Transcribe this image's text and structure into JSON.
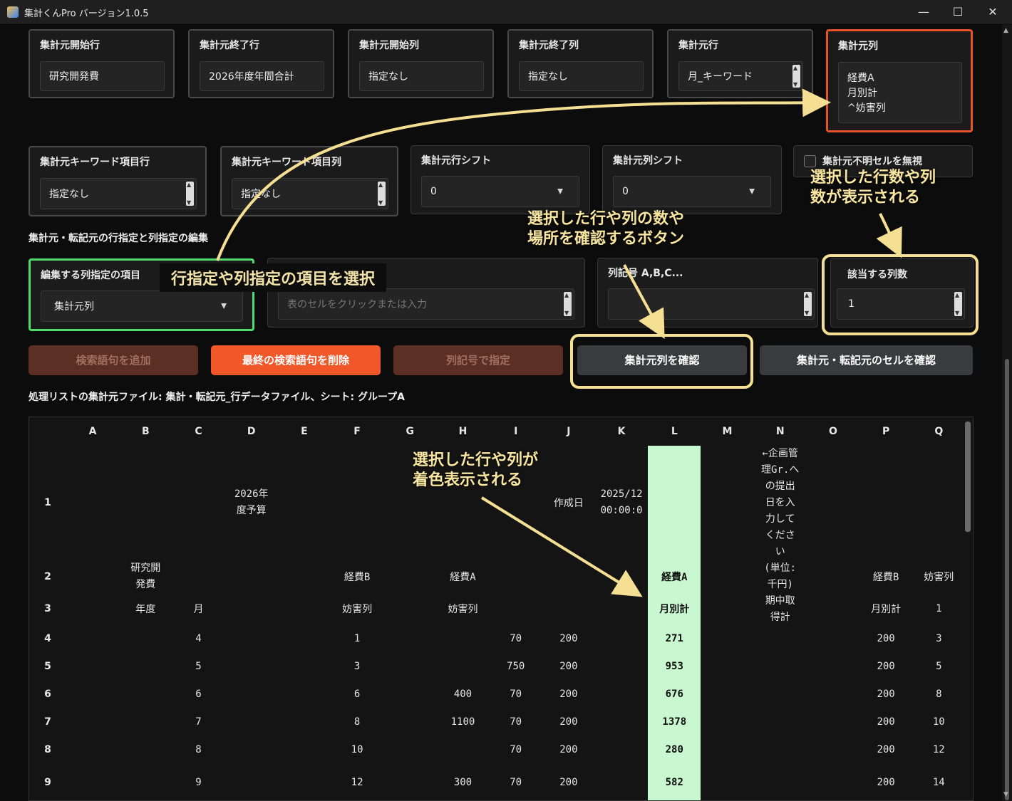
{
  "window": {
    "title": "集計くんPro バージョン1.0.5",
    "min": "—",
    "max": "☐",
    "close": "✕"
  },
  "row1": [
    {
      "label": "集計元開始行",
      "value": "研究開発費"
    },
    {
      "label": "集計元終了行",
      "value": "2026年度年間合計"
    },
    {
      "label": "集計元開始列",
      "value": "指定なし"
    },
    {
      "label": "集計元終了列",
      "value": "指定なし"
    },
    {
      "label": "集計元行",
      "value": "月_キーワード"
    },
    {
      "label": "集計元列",
      "lines": [
        "経費A",
        "月別計",
        "^妨害列"
      ]
    }
  ],
  "row2": [
    {
      "label": "集計元キーワード項目行",
      "value": "指定なし"
    },
    {
      "label": "集計元キーワード項目列",
      "value": "指定なし"
    },
    {
      "label": "集計元行シフト",
      "value": "0"
    },
    {
      "label": "集計元列シフト",
      "value": "0"
    },
    {
      "label": "集計元不明セルを無視"
    }
  ],
  "section_title": "集計元・転記元の行指定と列指定の編集",
  "edit": {
    "col_item_label": "編集する列指定の項目",
    "col_item_value": "集計元列",
    "input_placeholder": "表のセルをクリックまたは入力",
    "colnum_label": "列記号 A,B,C...",
    "count_label": "該当する列数",
    "count_value": "1"
  },
  "buttons": {
    "add": "検索語句を追加",
    "del": "最終の検索語句を削除",
    "by_col": "列記号で指定",
    "check_col": "集計元列を確認",
    "check_cells": "集計元・転記元のセルを確認"
  },
  "file_info": "処理リストの集計元ファイル: 集計・転記元_行データファイル、シート: グループA",
  "annotations": {
    "a1": "行指定や列指定の項目を選択",
    "a2": [
      "選択した行数や列",
      "数が表示される"
    ],
    "a3": [
      "選択した行や列の数や",
      "場所を確認するボタン"
    ],
    "a4": [
      "選択した行や列が",
      "着色表示される"
    ]
  },
  "sheet": {
    "cols": [
      "A",
      "B",
      "C",
      "D",
      "E",
      "F",
      "G",
      "H",
      "I",
      "J",
      "K",
      "L",
      "M",
      "N",
      "O",
      "P",
      "Q"
    ],
    "rows": [
      "1",
      "2",
      "3",
      "4",
      "5",
      "6",
      "7",
      "8",
      "9"
    ],
    "r1": {
      "D": [
        "2026年",
        "度予算"
      ],
      "J": "作成日",
      "K": [
        "2025/12",
        "00:00:0"
      ],
      "N": [
        "←企画管",
        "理Gr.へ",
        "の提出",
        "日を入",
        "力して",
        "くださ",
        "い"
      ]
    },
    "r2": {
      "B": [
        "研究開",
        "発費"
      ],
      "F": "経費B",
      "H": "経費A",
      "L": "経費A",
      "N": [
        "(単位:",
        "千円)"
      ],
      "P": "経費B",
      "Q": "妨害列"
    },
    "r3": {
      "B": "年度",
      "C": "月",
      "F": "妨害列",
      "H": "妨害列",
      "L": "月別計",
      "N": [
        "期中取",
        "得計"
      ],
      "P": "月別計",
      "Q": "1"
    },
    "data": [
      {
        "C": "4",
        "F": "1",
        "H": "",
        "I": "70",
        "J": "200",
        "L": "271",
        "P": "200",
        "Q": "3"
      },
      {
        "C": "5",
        "F": "3",
        "H": "",
        "I": "750",
        "J": "200",
        "L": "953",
        "P": "200",
        "Q": "5"
      },
      {
        "C": "6",
        "F": "6",
        "H": "400",
        "I": "70",
        "J": "200",
        "L": "676",
        "P": "200",
        "Q": "8"
      },
      {
        "C": "7",
        "F": "8",
        "H": "1100",
        "I": "70",
        "J": "200",
        "L": "1378",
        "P": "200",
        "Q": "10"
      },
      {
        "C": "8",
        "F": "10",
        "H": "",
        "I": "70",
        "J": "200",
        "L": "280",
        "P": "200",
        "Q": "12"
      },
      {
        "C": "9",
        "F": "12",
        "H": "300",
        "I": "70",
        "J": "200",
        "L": "582",
        "P": "200",
        "Q": "14"
      }
    ]
  }
}
